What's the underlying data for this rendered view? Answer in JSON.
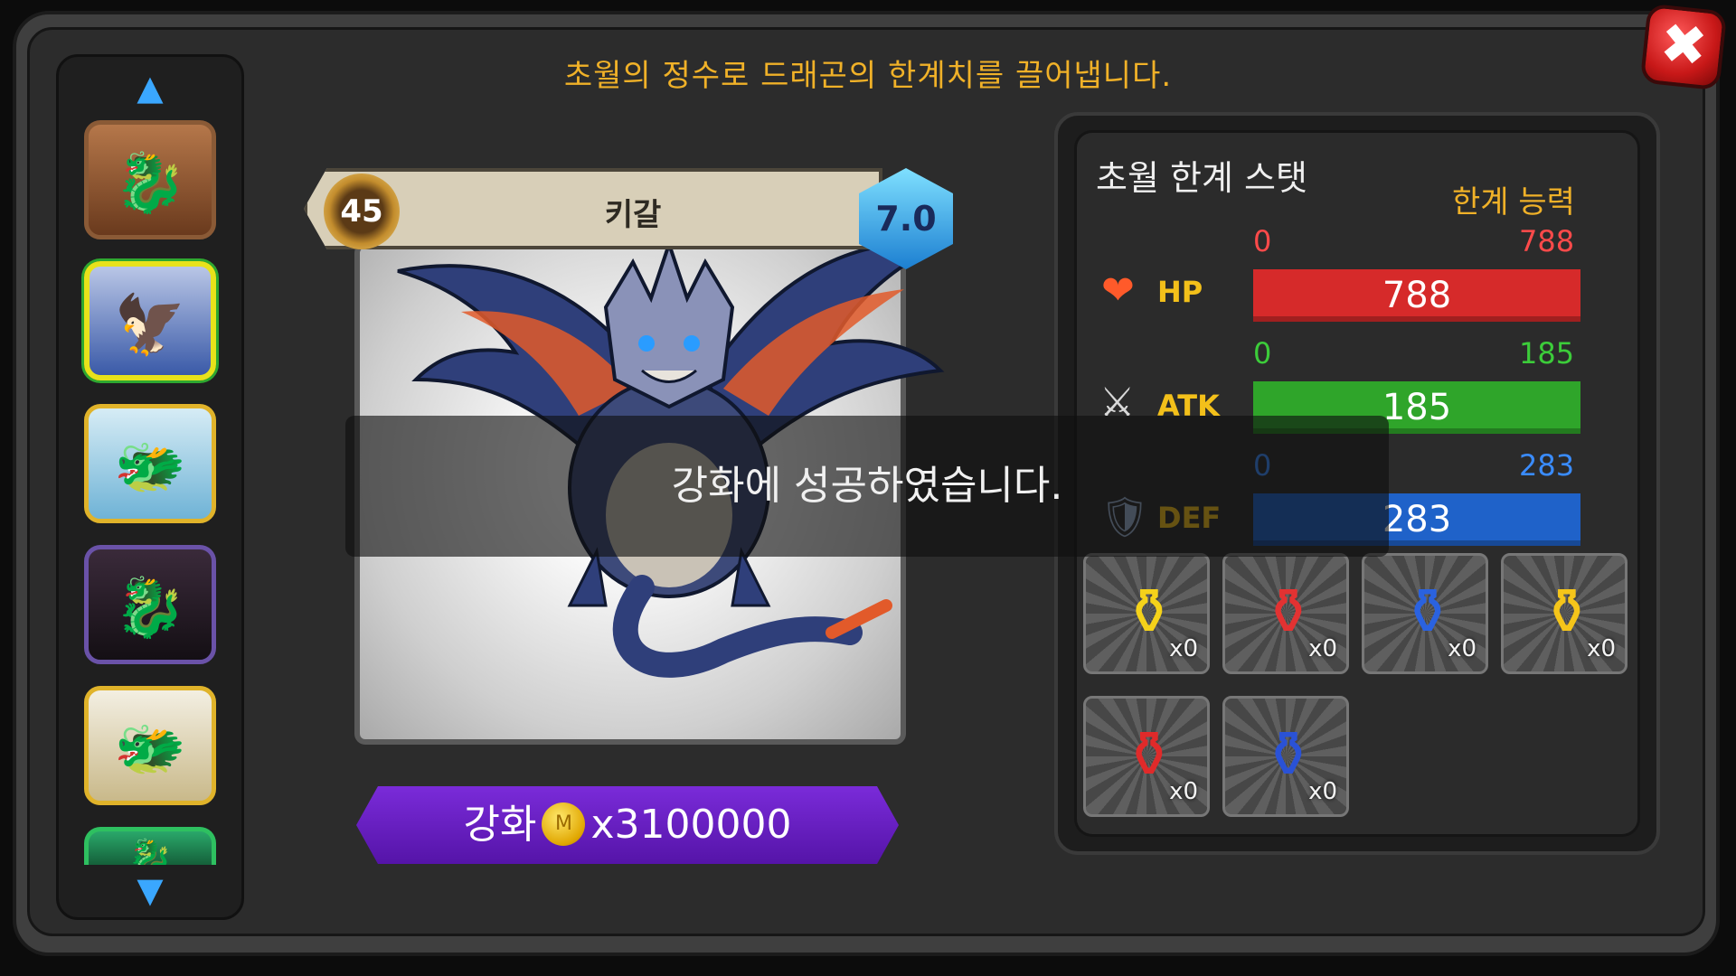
{
  "header": {
    "subtitle": "초월의 정수로 드래곤의 한계치를 끌어냅니다."
  },
  "close": {
    "icon": "close-x-icon",
    "label": "✖"
  },
  "dragon_list": {
    "up_arrow": "▲",
    "down_arrow": "▼",
    "items": [
      {
        "icon": "dragon-portrait-brown-icon",
        "glyph": "🐉",
        "selected": false
      },
      {
        "icon": "dragon-portrait-kigal-icon",
        "glyph": "🦅",
        "selected": true
      },
      {
        "icon": "dragon-portrait-ice-icon",
        "glyph": "🐲",
        "selected": false
      },
      {
        "icon": "dragon-portrait-dark-icon",
        "glyph": "🐉",
        "selected": false
      },
      {
        "icon": "dragon-portrait-white-gold-icon",
        "glyph": "🐲",
        "selected": false
      },
      {
        "icon": "dragon-portrait-green-icon",
        "glyph": "🐉",
        "selected": false
      }
    ]
  },
  "dragon": {
    "level": "45",
    "name": "키갈",
    "grade": "7.0"
  },
  "enhance": {
    "label": "강화",
    "coin_symbol": "M",
    "cost": "x3100000"
  },
  "toast": {
    "message": "강화에 성공하였습니다."
  },
  "stats": {
    "title": "초월 한계 스탯",
    "limit_label": "한계 능력",
    "rows": [
      {
        "key": "HP",
        "icon": "heart-icon",
        "glyph": "❤",
        "min": "0",
        "max": "788",
        "value": "788",
        "fill": 1.0,
        "color": "#d62a2a",
        "range_color": "#ff4a4a",
        "label_color": "#f3c01a"
      },
      {
        "key": "ATK",
        "icon": "crossed-swords-icon",
        "glyph": "⚔",
        "min": "0",
        "max": "185",
        "value": "185",
        "fill": 1.0,
        "color": "#2fa52a",
        "range_color": "#3ccc3a",
        "label_color": "#f3c01a"
      },
      {
        "key": "DEF",
        "icon": "shield-icon",
        "glyph": "🛡",
        "min": "0",
        "max": "283",
        "value": "283",
        "fill": 1.0,
        "color": "#1f62c9",
        "range_color": "#3a8cff",
        "label_color": "#f3c01a"
      }
    ]
  },
  "essences": [
    {
      "icon": "yellow-potion-icon",
      "glyph": "⚱",
      "color": "#f5d21a",
      "count": "x0"
    },
    {
      "icon": "red-potion-icon",
      "glyph": "⚱",
      "color": "#e23232",
      "count": "x0"
    },
    {
      "icon": "blue-potion-icon",
      "glyph": "⚱",
      "color": "#2a62e0",
      "count": "x0"
    },
    {
      "icon": "large-yellow-potion-icon",
      "glyph": "⚱",
      "color": "#f5c51a",
      "count": "x0"
    },
    {
      "icon": "large-red-potion-icon",
      "glyph": "⚱",
      "color": "#e02a2a",
      "count": "x0"
    },
    {
      "icon": "large-blue-potion-icon",
      "glyph": "⚱",
      "color": "#2a52d6",
      "count": "x0"
    }
  ]
}
